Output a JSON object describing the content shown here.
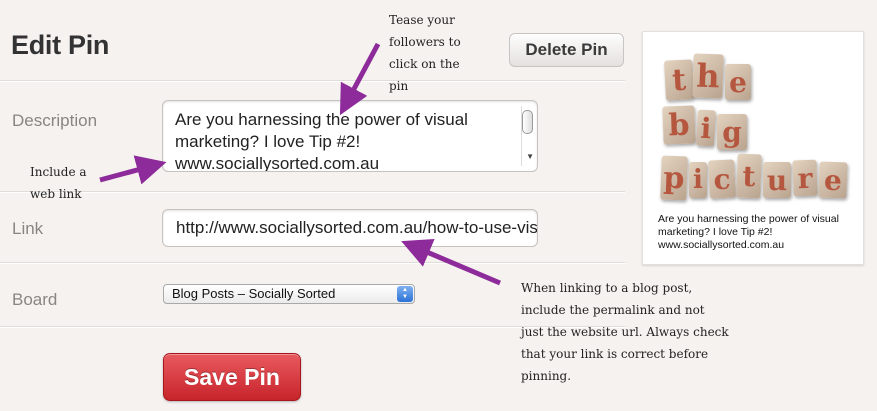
{
  "header": {
    "title": "Edit Pin",
    "delete_label": "Delete Pin"
  },
  "form": {
    "description_label": "Description",
    "description_value": "Are you harnessing the power of visual marketing? I love Tip #2! www.sociallysorted.com.au",
    "link_label": "Link",
    "link_value": "http://www.sociallysorted.com.au/how-to-use-visual-marketing",
    "board_label": "Board",
    "board_selected": "Blog Posts – Socially Sorted",
    "save_label": "Save Pin"
  },
  "preview": {
    "image_letters": [
      "t",
      "h",
      "e",
      "b",
      "i",
      "g",
      "p",
      "i",
      "c",
      "t",
      "u",
      "r",
      "e"
    ],
    "caption": "Are you harnessing the power of visual marketing? I love Tip #2! www.sociallysorted.com.au"
  },
  "annotations": {
    "tease": [
      "Tease your",
      "followers to",
      "click on the",
      "pin"
    ],
    "weblink": [
      "Include a",
      "web link"
    ],
    "permalink": [
      "When linking to a blog post,",
      "include the permalink and not",
      "just the website url. Always check",
      "that your link is correct before",
      "pinning."
    ]
  },
  "colors": {
    "save_button": "#c8242b",
    "annotation_arrow": "#8e2b9a",
    "page_background": "#f5f2f0"
  }
}
